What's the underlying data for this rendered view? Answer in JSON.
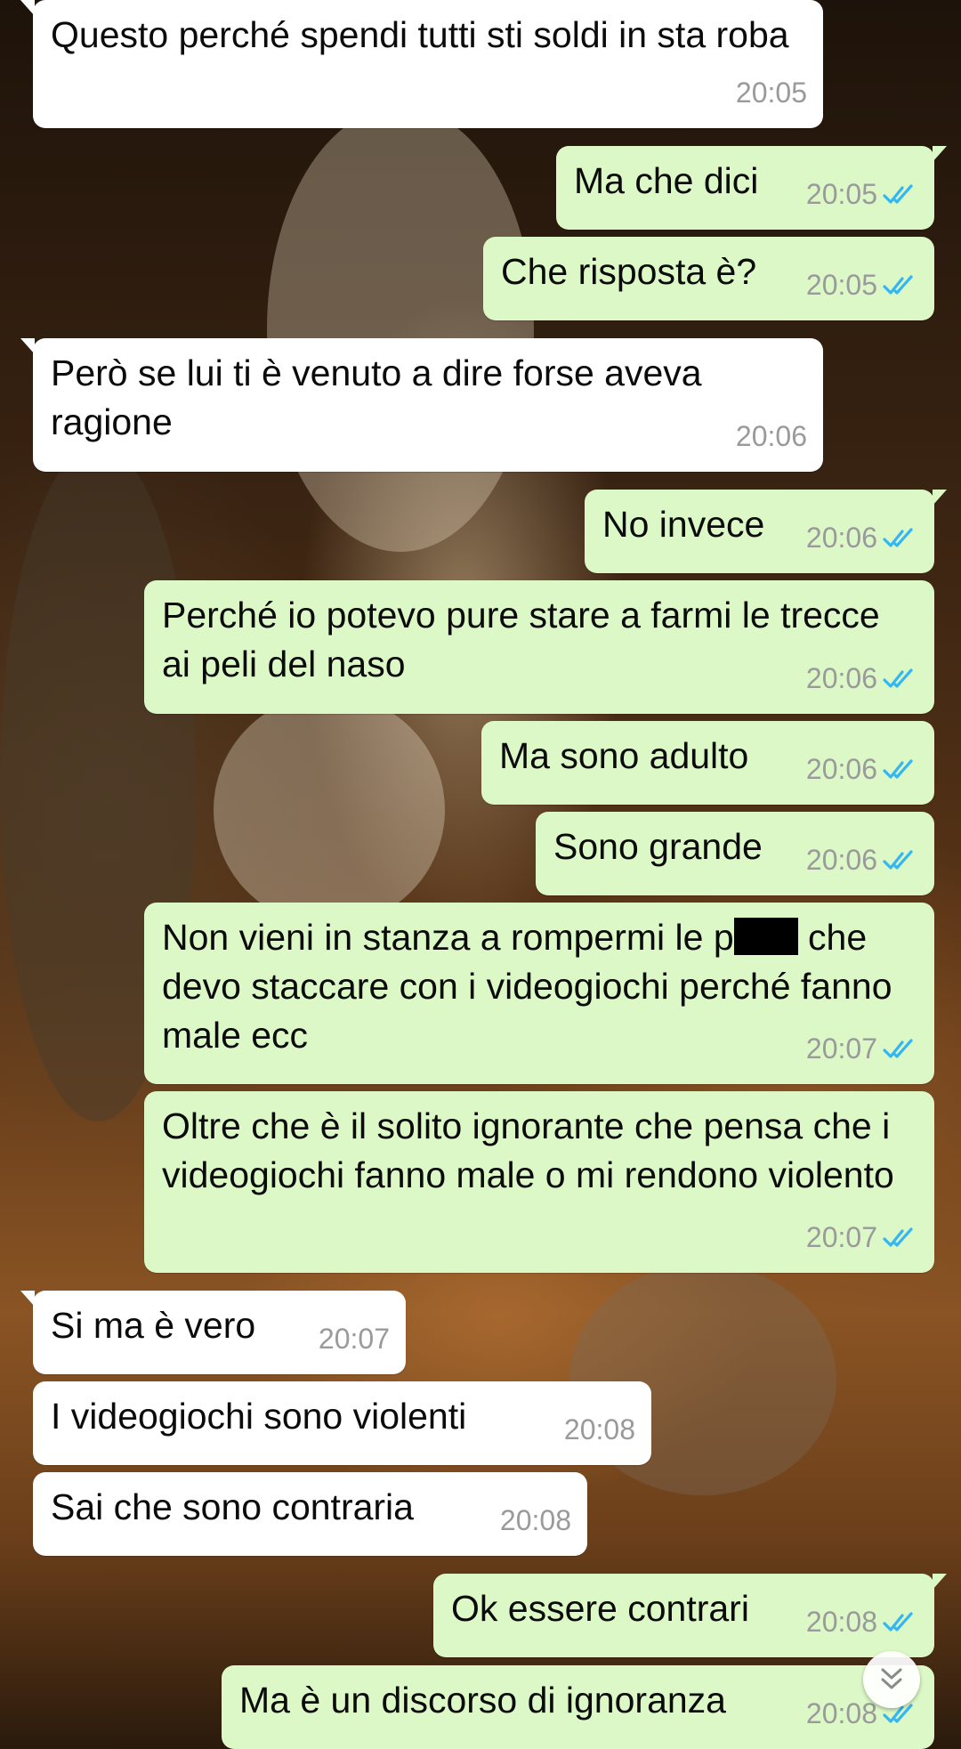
{
  "messages": [
    {
      "dir": "in",
      "text": "Questo perché spendi tutti sti soldi in sta roba",
      "time": "20:05"
    },
    {
      "dir": "out",
      "text": "Ma che dici",
      "time": "20:05"
    },
    {
      "dir": "out",
      "text": "Che risposta è?",
      "time": "20:05"
    },
    {
      "dir": "in",
      "text": "Però se lui ti è venuto a dire forse aveva ragione",
      "time": "20:06"
    },
    {
      "dir": "out",
      "text": "No invece",
      "time": "20:06"
    },
    {
      "dir": "out",
      "text": "Perché io potevo pure stare a farmi le trecce ai peli del naso",
      "time": "20:06"
    },
    {
      "dir": "out",
      "text": "Ma sono adulto",
      "time": "20:06"
    },
    {
      "dir": "out",
      "text": "Sono grande",
      "time": "20:06"
    },
    {
      "dir": "out",
      "text_before": "Non vieni in stanza a rompermi le p",
      "text_after": "che devo staccare con i videogiochi perché fanno male ecc",
      "time": "20:07"
    },
    {
      "dir": "out",
      "text": "Oltre che è il solito ignorante che pensa che i videogiochi fanno male o mi rendono violento",
      "time": "20:07"
    },
    {
      "dir": "in",
      "text": "Si ma è vero",
      "time": "20:07"
    },
    {
      "dir": "in",
      "text": "I videogiochi sono violenti",
      "time": "20:08"
    },
    {
      "dir": "in",
      "text": "Sai che sono contraria",
      "time": "20:08"
    },
    {
      "dir": "out",
      "text": "Ok essere contrari",
      "time": "20:08"
    },
    {
      "dir": "out",
      "text": "Ma è un discorso di ignoranza",
      "time": "20:08"
    }
  ],
  "colors": {
    "incoming_bubble": "#ffffff",
    "outgoing_bubble": "#dcf8c6",
    "read_ticks": "#34b7f1",
    "timestamp": "#9a9a9a"
  },
  "icons": {
    "read_receipt": "double-check-icon",
    "scroll_down": "double-chevron-down-icon"
  }
}
